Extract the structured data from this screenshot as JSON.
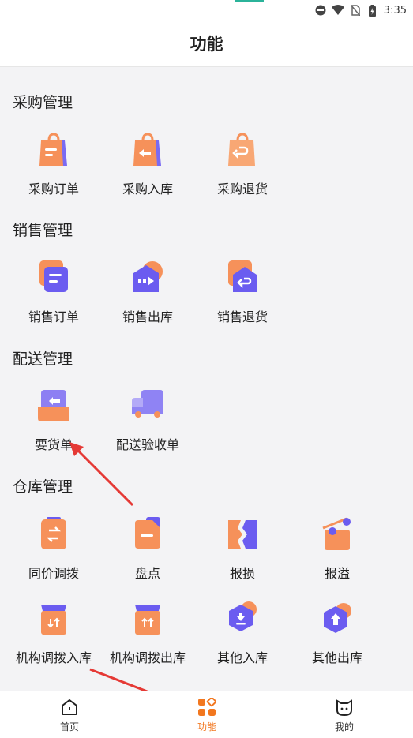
{
  "status_bar": {
    "time": "3:35"
  },
  "header": {
    "title": "功能"
  },
  "sections": [
    {
      "title": "采购管理",
      "items": [
        "采购订单",
        "采购入库",
        "采购退货"
      ]
    },
    {
      "title": "销售管理",
      "items": [
        "销售订单",
        "销售出库",
        "销售退货"
      ]
    },
    {
      "title": "配送管理",
      "items": [
        "要货单",
        "配送验收单"
      ]
    },
    {
      "title": "仓库管理",
      "items": [
        "同价调拨",
        "盘点",
        "报损",
        "报溢",
        "机构调拨入库",
        "机构调拨出库",
        "其他入库",
        "其他出库"
      ]
    }
  ],
  "tabbar": {
    "tabs": [
      {
        "label": "首页",
        "icon": "home-icon"
      },
      {
        "label": "功能",
        "icon": "grid-icon",
        "active": true
      },
      {
        "label": "我的",
        "icon": "cat-face-icon"
      }
    ]
  },
  "colors": {
    "accent": "#f2771f",
    "purple": "#6b5cf0",
    "orange": "#f6915a"
  }
}
